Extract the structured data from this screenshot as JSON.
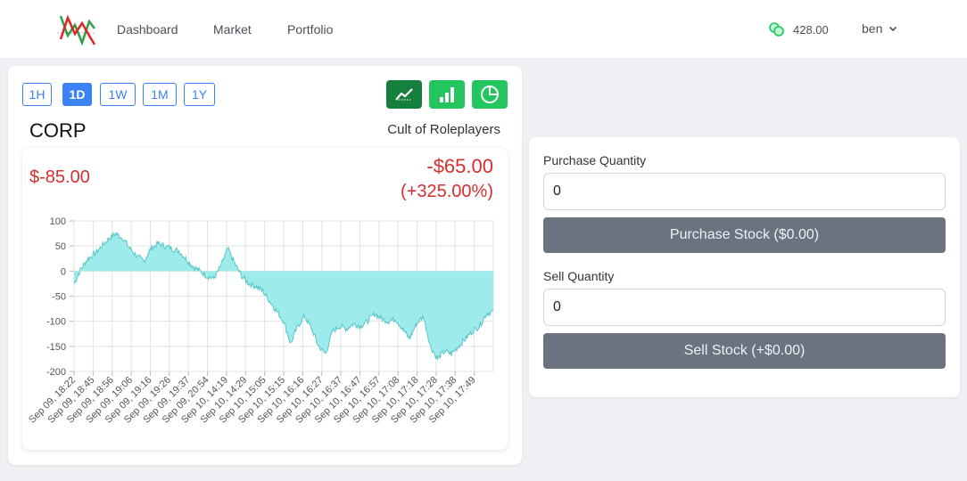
{
  "nav": {
    "links": [
      "Dashboard",
      "Market",
      "Portfolio"
    ],
    "balance": "428.00",
    "username": "ben"
  },
  "chart_panel": {
    "ranges": [
      {
        "label": "1H",
        "active": false
      },
      {
        "label": "1D",
        "active": true
      },
      {
        "label": "1W",
        "active": false
      },
      {
        "label": "1M",
        "active": false
      },
      {
        "label": "1Y",
        "active": false
      }
    ],
    "chart_types": [
      {
        "icon": "line-chart-icon",
        "color": "#15803d"
      },
      {
        "icon": "bar-chart-icon",
        "color": "#22c55e"
      },
      {
        "icon": "pie-chart-icon",
        "color": "#22c55e"
      }
    ],
    "ticker": "CORP",
    "company_name": "Cult of Roleplayers",
    "change_left": "$-85.00",
    "change_amount": "-$65.00",
    "change_percent": "(+325.00%)"
  },
  "chart_data": {
    "type": "area",
    "ylim": [
      -200,
      100
    ],
    "y_ticks": [
      100,
      50,
      0,
      -50,
      -100,
      -150,
      -200
    ],
    "x_ticks": [
      "Sep 09, 18:22",
      "Sep 09, 18:45",
      "Sep 09, 18:56",
      "Sep 09, 19:06",
      "Sep 09, 19:16",
      "Sep 09, 19:26",
      "Sep 09, 19:37",
      "Sep 09, 20:54",
      "Sep 10, 14:19",
      "Sep 10, 14:29",
      "Sep 10, 15:05",
      "Sep 10, 15:15",
      "Sep 10, 16:16",
      "Sep 10, 16:27",
      "Sep 10, 16:37",
      "Sep 10, 16:47",
      "Sep 10, 16:57",
      "Sep 10, 17:08",
      "Sep 10, 17:18",
      "Sep 10, 17:28",
      "Sep 10, 17:38",
      "Sep 10, 17:49"
    ],
    "values": [
      -25,
      5,
      25,
      35,
      50,
      65,
      75,
      65,
      45,
      30,
      20,
      45,
      55,
      50,
      45,
      40,
      25,
      10,
      0,
      -10,
      -15,
      10,
      45,
      15,
      -10,
      -25,
      -30,
      -40,
      -60,
      -80,
      -100,
      -145,
      -110,
      -90,
      -115,
      -150,
      -165,
      -120,
      -110,
      -115,
      -105,
      -110,
      -100,
      -85,
      -95,
      -100,
      -95,
      -115,
      -135,
      -105,
      -90,
      -150,
      -175,
      -160,
      -165,
      -150,
      -135,
      -120,
      -110,
      -85,
      -80
    ],
    "fill_color": "#9debeb",
    "line_color": "#5bc6c6",
    "grid": true
  },
  "trade": {
    "purchase_label": "Purchase Quantity",
    "purchase_value": "0",
    "purchase_button": "Purchase Stock ($0.00)",
    "sell_label": "Sell Quantity",
    "sell_value": "0",
    "sell_button": "Sell Stock (+$0.00)",
    "button_color": "#6b7280"
  }
}
